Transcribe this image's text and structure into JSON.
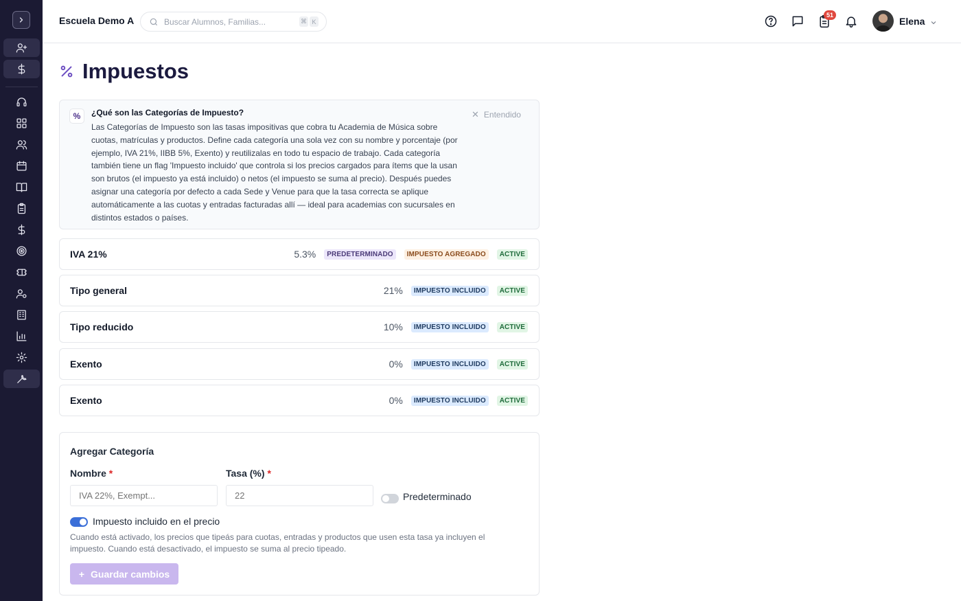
{
  "topbar": {
    "school_name": "Escuela Demo A",
    "search_placeholder": "Buscar Alumnos, Familias...",
    "shortcut_keys": [
      "⌘",
      "K"
    ],
    "notification_count": "51",
    "user_name": "Elena"
  },
  "sidebar": {
    "items": [
      {
        "icon": "user-plus-icon"
      },
      {
        "icon": "dollar-icon"
      },
      {
        "icon": "headset-icon"
      },
      {
        "icon": "grid-icon"
      },
      {
        "icon": "users-icon"
      },
      {
        "icon": "calendar-icon"
      },
      {
        "icon": "book-icon"
      },
      {
        "icon": "clipboard-icon"
      },
      {
        "icon": "dollar-icon"
      },
      {
        "icon": "target-icon"
      },
      {
        "icon": "ticket-icon"
      },
      {
        "icon": "user-gear-icon"
      },
      {
        "icon": "building-icon"
      },
      {
        "icon": "chart-icon"
      },
      {
        "icon": "gear-icon"
      },
      {
        "icon": "wrench-icon"
      }
    ],
    "active_item": "wrench-icon"
  },
  "page": {
    "title": "Impuestos"
  },
  "info": {
    "title": "¿Qué son las Categorías de Impuesto?",
    "body": "Las Categorías de Impuesto son las tasas impositivas que cobra tu Academia de Música sobre cuotas, matrículas y productos. Define cada categoría una sola vez con su nombre y porcentaje (por ejemplo, IVA 21%, IIBB 5%, Exento) y reutilizalas en todo tu espacio de trabajo. Cada categoría también tiene un flag 'Impuesto incluido' que controla si los precios cargados para ítems que la usan son brutos (el impuesto ya está incluido) o netos (el impuesto se suma al precio). Después puedes asignar una categoría por defecto a cada Sede y Venue para que la tasa correcta se aplique automáticamente a las cuotas y entradas facturadas allí — ideal para academias con sucursales en distintos estados o países.",
    "dismiss_label": "Entendido"
  },
  "tax_categories": [
    {
      "name": "IVA 21%",
      "rate": "5.3%",
      "badges": [
        "PREDETERMINADO",
        "IMPUESTO AGREGADO",
        "ACTIVE"
      ]
    },
    {
      "name": "Tipo general",
      "rate": "21%",
      "badges": [
        "IMPUESTO INCLUIDO",
        "ACTIVE"
      ]
    },
    {
      "name": "Tipo reducido",
      "rate": "10%",
      "badges": [
        "IMPUESTO INCLUIDO",
        "ACTIVE"
      ]
    },
    {
      "name": "Exento",
      "rate": "0%",
      "badges": [
        "IMPUESTO INCLUIDO",
        "ACTIVE"
      ]
    },
    {
      "name": "Exento",
      "rate": "0%",
      "badges": [
        "IMPUESTO INCLUIDO",
        "ACTIVE"
      ]
    }
  ],
  "form": {
    "title": "Agregar Categoría",
    "name_label": "Nombre",
    "name_placeholder": "IVA 22%, Exempt...",
    "rate_label": "Tasa (%)",
    "rate_placeholder": "22",
    "required_marker": "*",
    "default_toggle_label": "Predeterminado",
    "default_toggle_on": false,
    "included_toggle_label": "Impuesto incluido en el precio",
    "included_toggle_on": true,
    "hint": "Cuando está activado, los precios que tipeás para cuotas, entradas y productos que usen esta tasa ya incluyen el impuesto. Cuando está desactivado, el impuesto se suma al precio tipeado.",
    "save_label": "Guardar cambios",
    "save_icon": "+"
  },
  "colors": {
    "sidebar_bg": "#1b1a33",
    "title": "#1b1a3f",
    "accent": "#6d4fc2",
    "toggle_on": "#3b6fd8",
    "badge_default_bg": "#ece6fb",
    "badge_added_bg": "#fdf0e2",
    "badge_included_bg": "#dbeafe",
    "badge_active_bg": "#e1f5e5",
    "notification": "#e0483e",
    "save_button_disabled": "#c9b7ee"
  }
}
